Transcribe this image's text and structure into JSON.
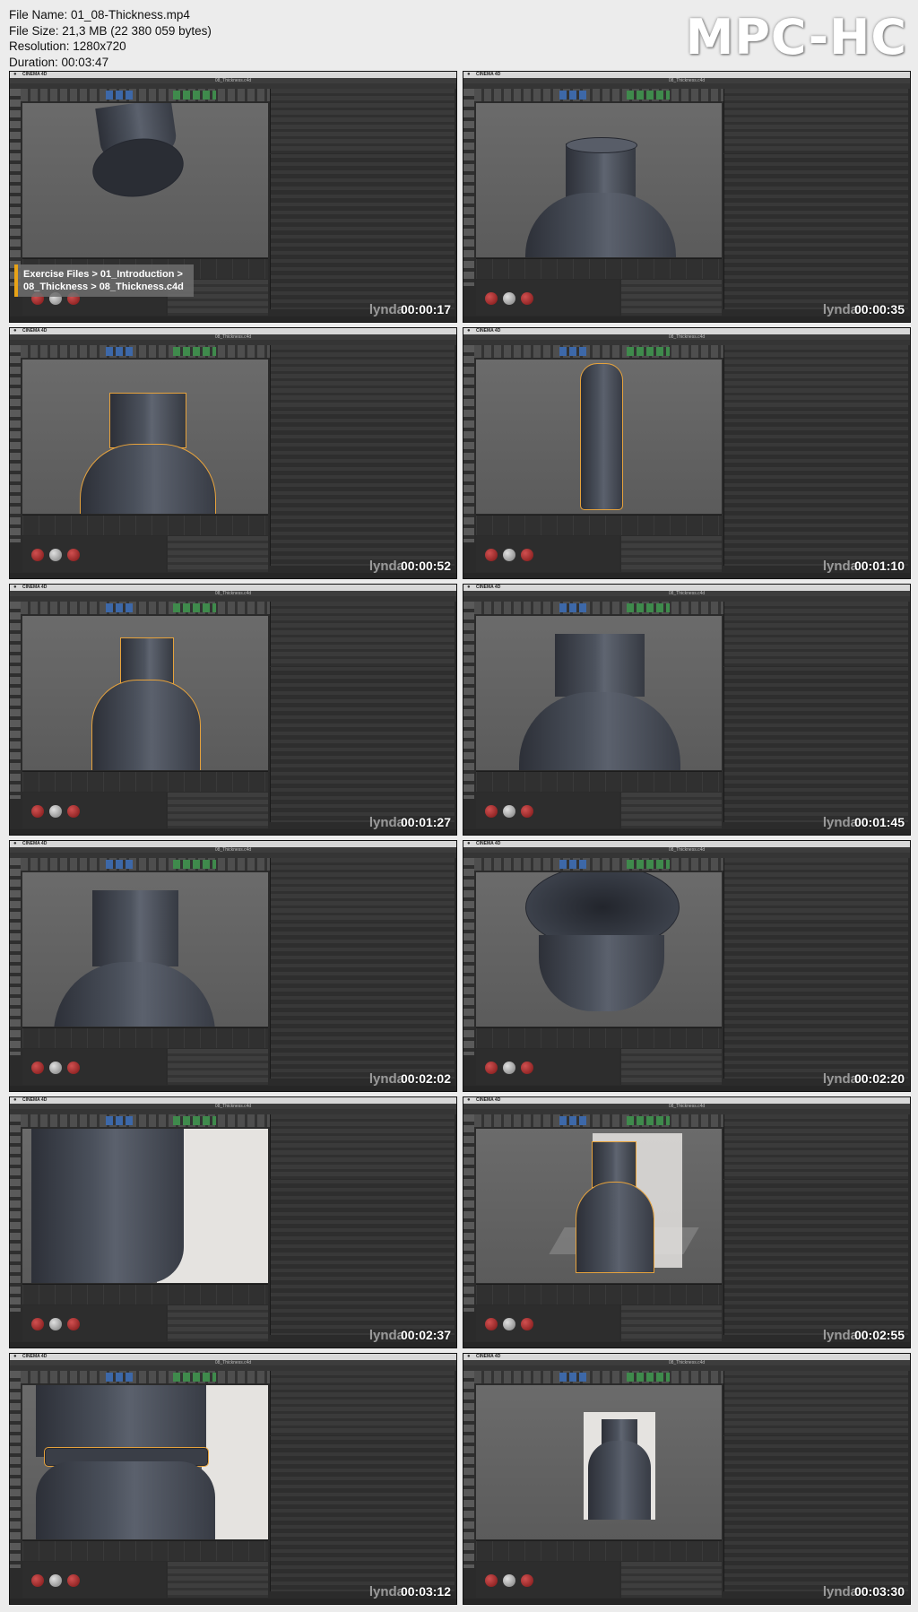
{
  "info": {
    "file_name": "File Name: 01_08-Thickness.mp4",
    "file_size": "File Size: 21,3 MB (22 380 059 bytes)",
    "resolution": "Resolution: 1280x720",
    "duration": "Duration: 00:03:47"
  },
  "player_logo": "MPC-HC",
  "app_name": "CINEMA 4D",
  "window_menu": "Window",
  "doc_title": "08_Thickness.c4d",
  "watermark": "lynda",
  "overlay": {
    "line1": "Exercise Files > 01_Introduction >",
    "line2": "08_Thickness > 08_Thickness.c4d"
  },
  "frames": [
    {
      "time": "00:00:17"
    },
    {
      "time": "00:00:35"
    },
    {
      "time": "00:00:52"
    },
    {
      "time": "00:01:10"
    },
    {
      "time": "00:01:27"
    },
    {
      "time": "00:01:45"
    },
    {
      "time": "00:02:02"
    },
    {
      "time": "00:02:20"
    },
    {
      "time": "00:02:37"
    },
    {
      "time": "00:02:55"
    },
    {
      "time": "00:03:12"
    },
    {
      "time": "00:03:30"
    }
  ],
  "colors": {
    "accent_orange": "#e8a317",
    "viewport_gray": "#666666",
    "ui_dark": "#2b2b2b"
  }
}
